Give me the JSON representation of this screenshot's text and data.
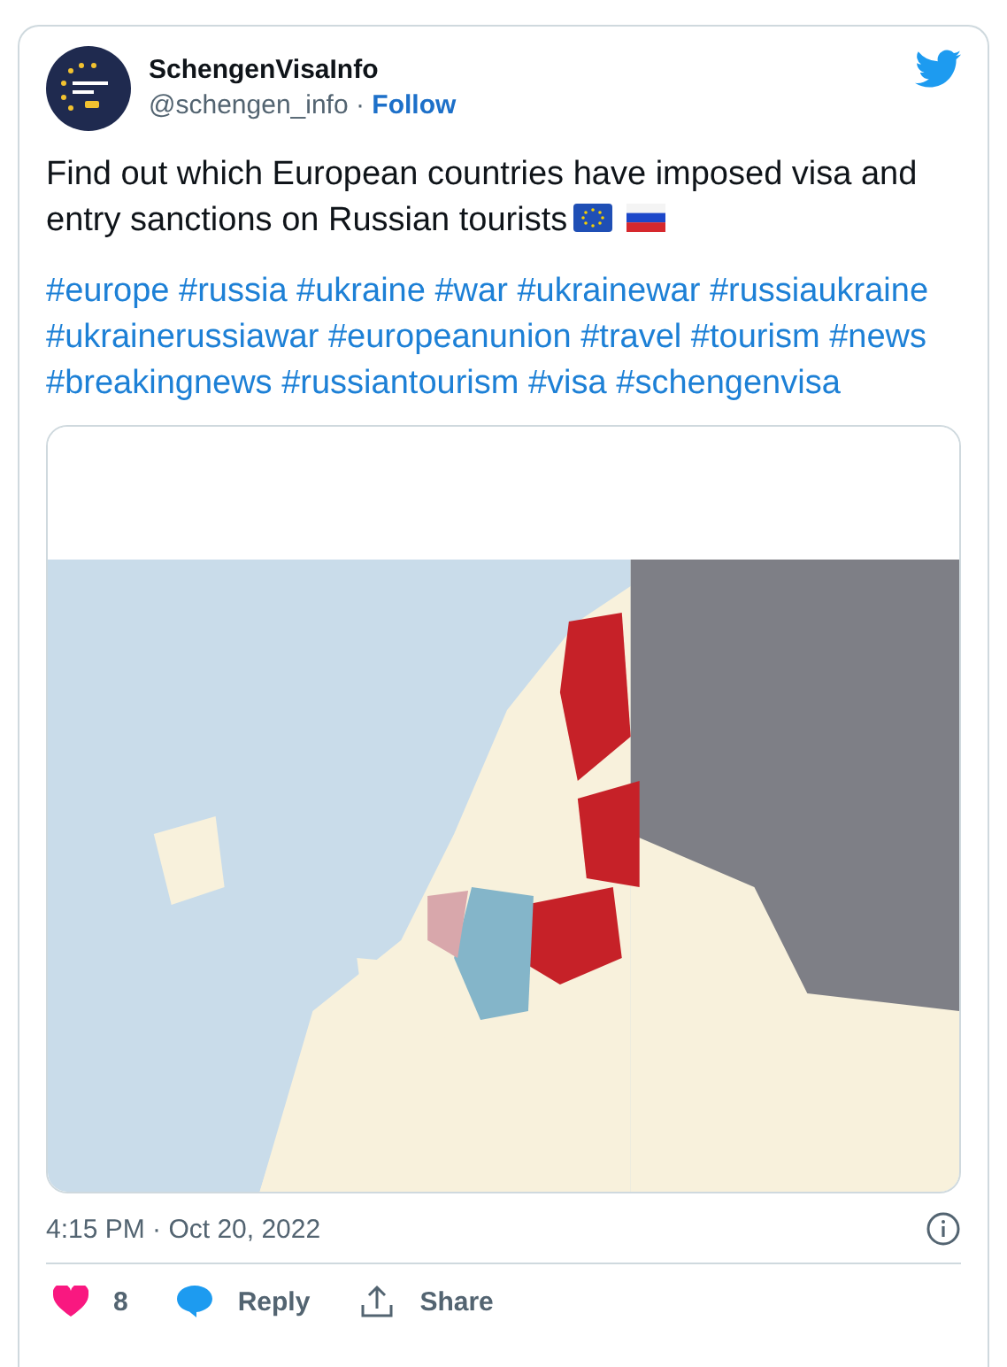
{
  "account": {
    "name": "SchengenVisaInfo",
    "handle": "@schengen_info",
    "separator": "·",
    "follow": "Follow"
  },
  "text_lines": [
    "Find out which European countries have imposed visa and",
    "entry sanctions on Russian tourists"
  ],
  "hashtags": [
    "#europe",
    "#russia",
    "#ukraine",
    "#war",
    "#ukrainewar",
    "#russiaukraine",
    "#ukrainerussiawar",
    "#europeanunion",
    "#travel",
    "#tourism",
    "#news",
    "#breakingnews",
    "#russiantourism",
    "#visa",
    "#schengenvisa"
  ],
  "timestamp": "4:15 PM · Oct 20, 2022",
  "actions": {
    "likes": "8",
    "reply": "Reply",
    "share": "Share"
  }
}
